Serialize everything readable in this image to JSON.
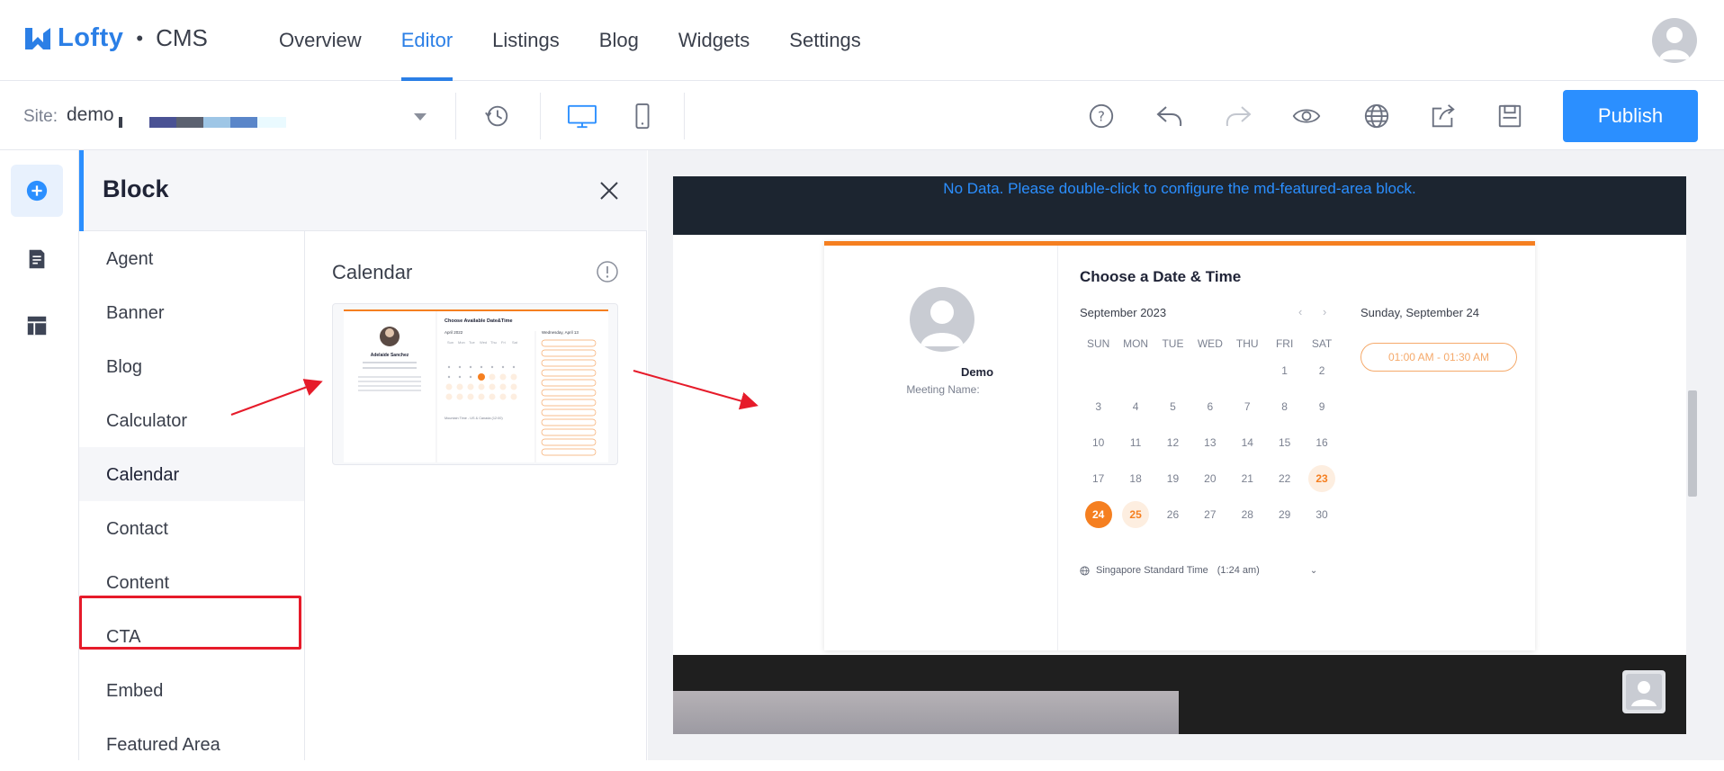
{
  "brand": {
    "name": "Lofty",
    "sep": "•",
    "product": "CMS",
    "color": "#2b7fe6"
  },
  "nav": {
    "tabs": [
      {
        "label": "Overview"
      },
      {
        "label": "Editor",
        "active": true
      },
      {
        "label": "Listings"
      },
      {
        "label": "Blog"
      },
      {
        "label": "Widgets"
      },
      {
        "label": "Settings"
      }
    ]
  },
  "toolbar": {
    "site_label": "Site:",
    "site_value": "demo",
    "publish_label": "Publish",
    "icons": [
      "history-icon",
      "desktop-icon",
      "mobile-icon",
      "help-icon",
      "undo-icon",
      "redo-icon",
      "preview-icon",
      "globe-icon",
      "export-icon",
      "save-icon"
    ]
  },
  "rail": {
    "items": [
      "add-block-icon",
      "page-icon",
      "layout-icon"
    ]
  },
  "panel": {
    "title": "Block",
    "categories": [
      "Agent",
      "Banner",
      "Blog",
      "Calculator",
      "Calendar",
      "Contact",
      "Content",
      "CTA",
      "Embed",
      "Featured Area"
    ],
    "selected": "Calendar",
    "preview_title": "Calendar",
    "thumb": {
      "heading": "Choose Available Date&Time",
      "name": "Adelaide Sanchez",
      "month": "April 2022",
      "date_head": "Wednesday, April 13",
      "tz": "Mountain Time - US & Canada (12:00)"
    }
  },
  "canvas": {
    "featured_msg": "No Data. Please double-click to configure the md-featured-area block.",
    "calendar": {
      "title": "Choose a Date & Time",
      "month": "September 2023",
      "weekdays": [
        "SUN",
        "MON",
        "TUE",
        "WED",
        "THU",
        "FRI",
        "SAT"
      ],
      "weeks": [
        [
          "",
          "",
          "",
          "",
          "",
          "1",
          "2"
        ],
        [
          "3",
          "4",
          "5",
          "6",
          "7",
          "8",
          "9"
        ],
        [
          "10",
          "11",
          "12",
          "13",
          "14",
          "15",
          "16"
        ],
        [
          "17",
          "18",
          "19",
          "20",
          "21",
          "22",
          "23"
        ],
        [
          "24",
          "25",
          "26",
          "27",
          "28",
          "29",
          "30"
        ]
      ],
      "available_days": [
        "23",
        "25"
      ],
      "selected_day": "24",
      "agent_name": "Demo",
      "meeting_label": "Meeting Name:",
      "date_head": "Sunday, September 24",
      "slot": "01:00 AM - 01:30 AM",
      "timezone": "Singapore Standard Time",
      "tz_time": "(1:24 am)"
    }
  },
  "colors": {
    "accent": "#2b8fff",
    "calendar_accent": "#f57f20",
    "annotation": "#e61b2a"
  }
}
